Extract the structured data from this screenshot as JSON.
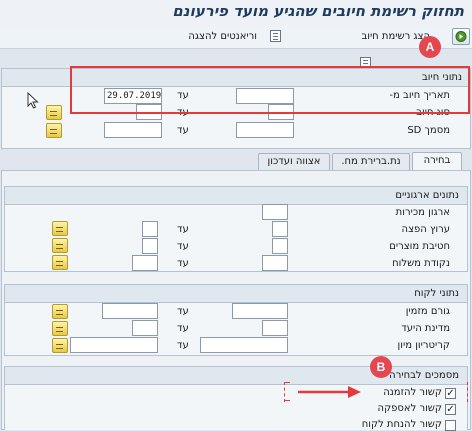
{
  "title": "תחזוק רשימת חיובים שהגיע מועד פירעונם",
  "toolbar": {
    "execute_icon": "execute-icon",
    "display_list_label": "הצג רשימת חיוב",
    "variants_label": "וריאנטים להצגה"
  },
  "billing_data": {
    "heading": "נתוני חיוב",
    "rows": [
      {
        "label": "תאריך חיוב מ-",
        "from": "",
        "to_label": "עד",
        "to": "29.07.2019"
      },
      {
        "label": "סוג חיוב",
        "from": "",
        "to_label": "עד",
        "to": ""
      },
      {
        "label": "מסמך SD",
        "from": "",
        "to_label": "עד",
        "to": ""
      }
    ]
  },
  "tabs": [
    "בחירה",
    "נת.ברירת מח.",
    "אצווה ועדכון"
  ],
  "org_data": {
    "heading": "נתונים ארגוניים",
    "rows": [
      {
        "label": "ארגון מכירות",
        "from": ""
      },
      {
        "label": "ערוץ הפצה",
        "from": "",
        "to_label": "עד",
        "to": ""
      },
      {
        "label": "חטיבת מוצרים",
        "from": "",
        "to_label": "עד",
        "to": ""
      },
      {
        "label": "נקודת משלוח",
        "from": "",
        "to_label": "עד",
        "to": ""
      }
    ]
  },
  "customer_data": {
    "heading": "נתוני לקוח",
    "rows": [
      {
        "label": "גורם מזמין",
        "from": "",
        "to_label": "עד",
        "to": ""
      },
      {
        "label": "מדינת היעד",
        "from": "",
        "to_label": "עד",
        "to": ""
      },
      {
        "label": "קריטריון מיון",
        "from": "",
        "to_label": "עד",
        "to": ""
      }
    ]
  },
  "docs_selection": {
    "heading": "מסמכים לבחירה",
    "items": [
      {
        "label": "קשור להזמנה",
        "checked": true
      },
      {
        "label": "קשור לאספקה",
        "checked": true
      },
      {
        "label": "קשור להנחת לקוח",
        "checked": false
      }
    ]
  },
  "annotations": {
    "a": "A",
    "b": "B",
    "accent": "#e33b3b"
  }
}
